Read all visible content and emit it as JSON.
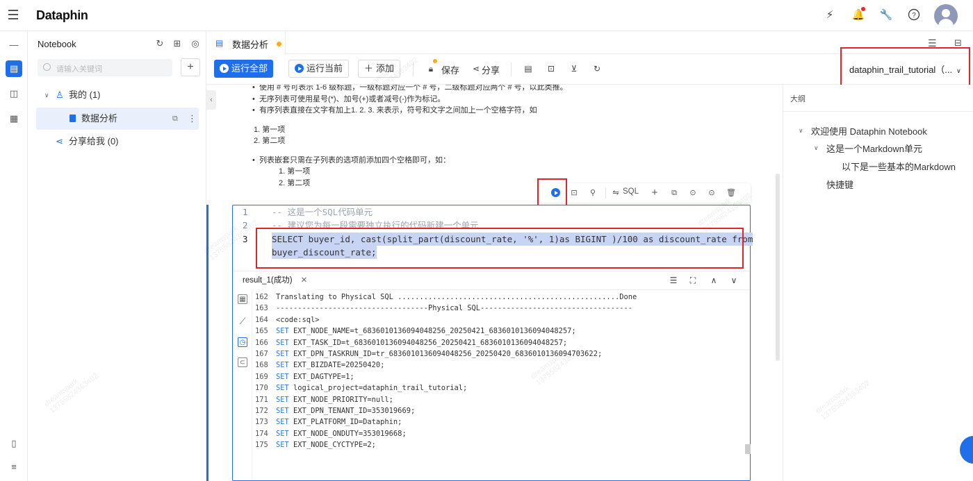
{
  "app": {
    "logo": "Dataphin"
  },
  "sidebar": {
    "title": "Notebook",
    "search_placeholder": "请输入关键词",
    "tree": {
      "mine_label": "我的 (1)",
      "notebook_name": "数据分析",
      "shared_label": "分享给我 (0)"
    }
  },
  "tab": {
    "label": "数据分析"
  },
  "toolbar": {
    "run_all": "运行全部",
    "run_current": "运行当前",
    "add": "添加",
    "save": "保存",
    "share": "分享",
    "project": "dataphin_trail_tutorial（..."
  },
  "markdown": {
    "line1": "使用 # 号可表示 1-6 级标题，一级标题对应一个 # 号，二级标题对应两个 # 号，以此类推。",
    "line2": "无序列表可使用星号(*)、加号(+)或者减号(-)作为标记。",
    "line3": "有序列表直接在文字有加上1. 2. 3. 来表示，符号和文字之间加上一个空格字符，如",
    "ol1": "1. 第一项",
    "ol2": "2. 第二项",
    "nested": "列表嵌套只需在子列表的选项前添加四个空格即可，如：",
    "n1": "1. 第一项",
    "n2": "2. 第二项"
  },
  "cell_toolbar": {
    "sql_label": "SQL"
  },
  "code": {
    "l1": "-- 这是一个SQL代码单元",
    "l2": "-- 建议您为每一段需要独立执行的代码新建一个单元",
    "l3a": "SELECT buyer_id, cast(split_part(discount_rate, '%', 1)as BIGINT )/100 as discount_rate from",
    "l3b": "buyer_discount_rate;",
    "n1": "1",
    "n2": "2",
    "n3": "3"
  },
  "result": {
    "tab_label": "result_1(成功)",
    "lines": [
      {
        "n": "162",
        "t": "Translating to Physical SQL ...................................................Done"
      },
      {
        "n": "163",
        "t": "-----------------------------------Physical SQL-----------------------------------"
      },
      {
        "n": "164",
        "t": "<code:sql>"
      },
      {
        "n": "165",
        "t": "EXT_NODE_NAME=t_6836010136094048256_20250421_6836010136094048257;"
      },
      {
        "n": "166",
        "t": "EXT_TASK_ID=t_6836010136094048256_20250421_6836010136094048257;"
      },
      {
        "n": "167",
        "t": "EXT_DPN_TASKRUN_ID=tr_6836010136094048256_20250420_6836010136094703622;"
      },
      {
        "n": "168",
        "t": "EXT_BIZDATE=20250420;"
      },
      {
        "n": "169",
        "t": "EXT_DAGTYPE=1;"
      },
      {
        "n": "170",
        "t": "logical_project=dataphin_trail_tutorial;"
      },
      {
        "n": "171",
        "t": "EXT_NODE_PRIORITY=null;"
      },
      {
        "n": "172",
        "t": "EXT_DPN_TENANT_ID=353019669;"
      },
      {
        "n": "173",
        "t": "EXT_PLATFORM_ID=Dataphin;"
      },
      {
        "n": "174",
        "t": "EXT_NODE_ONDUTY=353019668;"
      },
      {
        "n": "175",
        "t": "EXT_NODE_CYCTYPE=2;"
      }
    ],
    "set_kw": "SET"
  },
  "outline": {
    "title": "大纲",
    "items": [
      "欢迎使用 Dataphin Notebook",
      "这是一个Markdown单元",
      "以下是一些基本的Markdown",
      "快捷键"
    ]
  },
  "watermark": {
    "line1": "dreamspark",
    "line2": "13755824363402"
  },
  "colors": {
    "primary": "#1f6feb",
    "highlight_red": "#e0242c",
    "selection": "#c7d4f3"
  }
}
